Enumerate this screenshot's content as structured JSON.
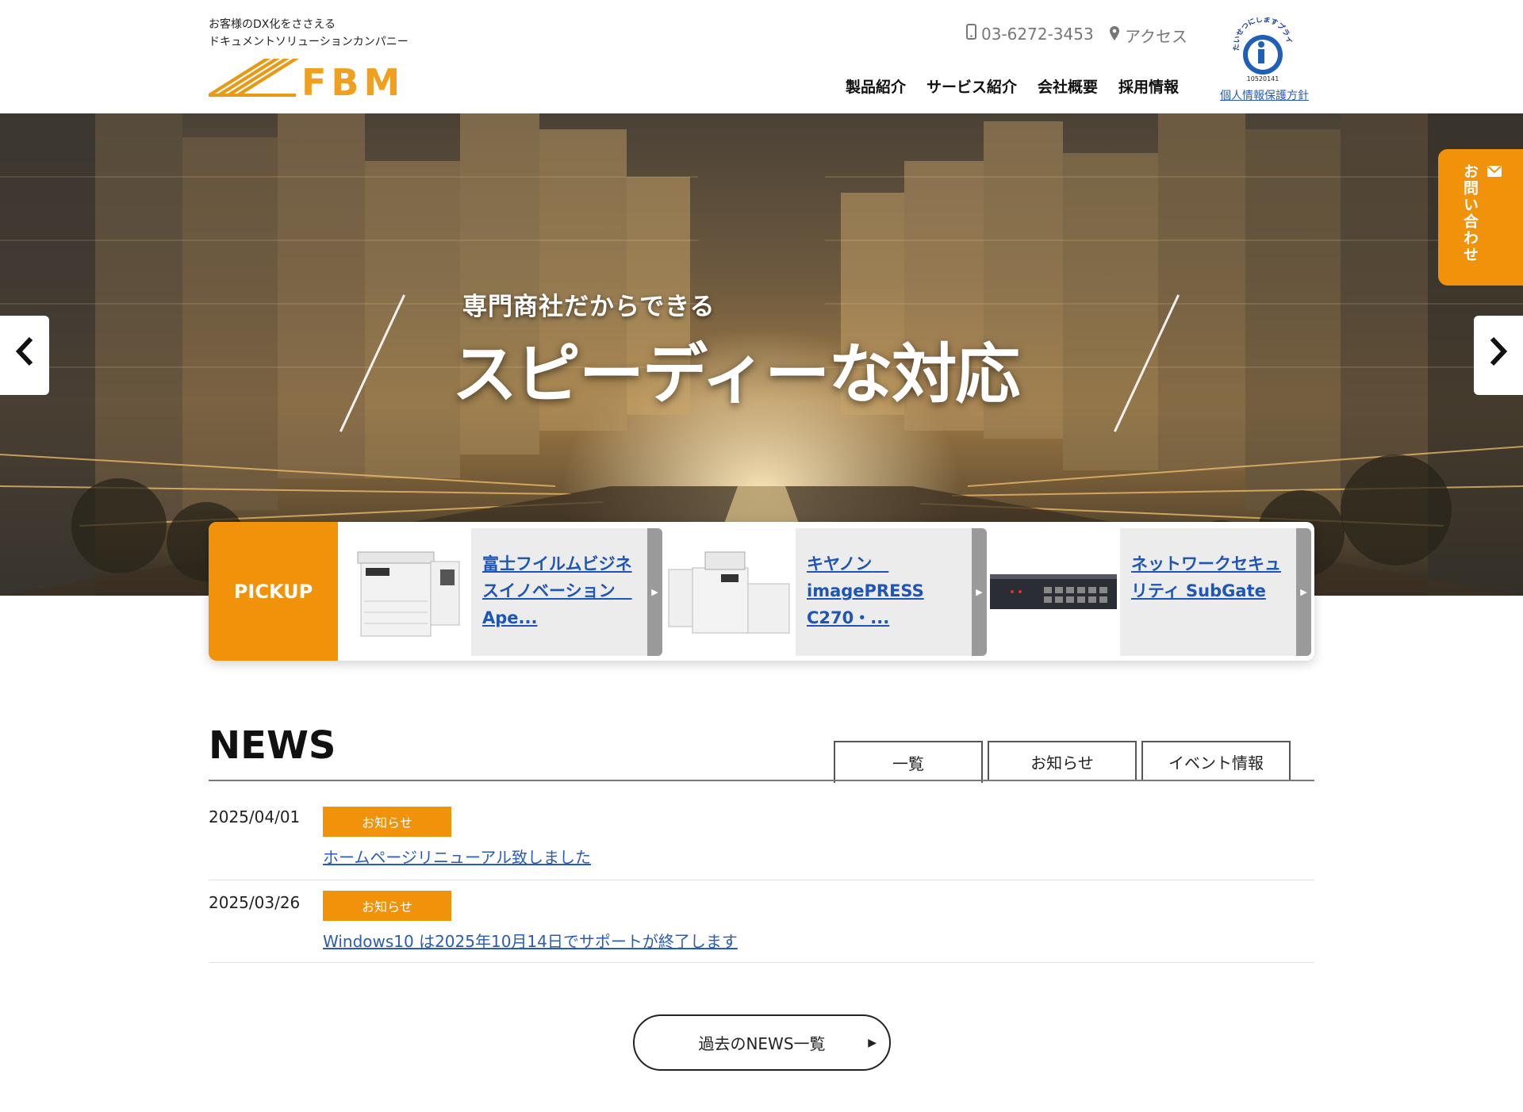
{
  "header": {
    "tagline_line1": "お客様のDX化をささえる",
    "tagline_line2": "ドキュメントソリューションカンパニー",
    "logo_text": "FBM",
    "phone": "03-6272-3453",
    "access": "アクセス",
    "nav": [
      "製品紹介",
      "サービス紹介",
      "会社概要",
      "採用情報"
    ],
    "privacy_mark_text": "たいせつにしますプライバシー",
    "privacy_mark_number": "10520141",
    "privacy_link": "個人情報保護方針"
  },
  "hero": {
    "subtitle": "専門商社だからできる",
    "title": "スピーディーな対応",
    "prev_icon": "chevron-left-icon",
    "next_icon": "chevron-right-icon"
  },
  "contact_tab": {
    "label": "お問い合わせ",
    "icon": "mail-icon"
  },
  "pickup": {
    "label": "PICKUP",
    "items": [
      {
        "text": "富士フイルムビジネスイノベーション　Ape...",
        "image": "multifunction-printer"
      },
      {
        "text": "キヤノン　imagePRESS C270・...",
        "image": "production-printer"
      },
      {
        "text": "ネットワークセキュリティ SubGate",
        "image": "network-switch"
      }
    ]
  },
  "news": {
    "title": "NEWS",
    "tabs": [
      "一覧",
      "お知らせ",
      "イベント情報"
    ],
    "items": [
      {
        "date": "2025/04/01",
        "category": "お知らせ",
        "title": "ホームページリニューアル致しました"
      },
      {
        "date": "2025/03/26",
        "category": "お知らせ",
        "title": "Windows10 は2025年10月14日でサポートが終了します"
      }
    ],
    "more_button": "過去のNEWS一覧"
  },
  "colors": {
    "accent": "#f0920a",
    "link": "#2a5bb5",
    "text": "#222222"
  }
}
